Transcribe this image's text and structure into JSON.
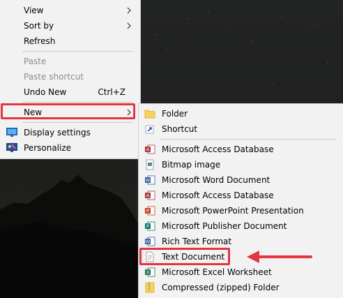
{
  "main_menu": {
    "items": [
      {
        "label": "View",
        "has_submenu": true,
        "enabled": true
      },
      {
        "label": "Sort by",
        "has_submenu": true,
        "enabled": true
      },
      {
        "label": "Refresh",
        "enabled": true
      },
      {
        "label": "Paste",
        "enabled": false
      },
      {
        "label": "Paste shortcut",
        "enabled": false
      },
      {
        "label": "Undo New",
        "shortcut": "Ctrl+Z",
        "enabled": true
      },
      {
        "label": "New",
        "has_submenu": true,
        "enabled": true,
        "highlighted": true
      },
      {
        "label": "Display settings",
        "icon": "display-settings-icon",
        "enabled": true
      },
      {
        "label": "Personalize",
        "icon": "personalize-icon",
        "enabled": true
      }
    ]
  },
  "new_submenu": {
    "items": [
      {
        "label": "Folder",
        "icon": "folder-icon"
      },
      {
        "label": "Shortcut",
        "icon": "shortcut-icon"
      },
      {
        "label": "Microsoft Access Database",
        "icon": "access-icon"
      },
      {
        "label": "Bitmap image",
        "icon": "bitmap-icon"
      },
      {
        "label": "Microsoft Word Document",
        "icon": "word-icon"
      },
      {
        "label": "Microsoft Access Database",
        "icon": "access-icon"
      },
      {
        "label": "Microsoft PowerPoint Presentation",
        "icon": "powerpoint-icon"
      },
      {
        "label": "Microsoft Publisher Document",
        "icon": "publisher-icon"
      },
      {
        "label": "Rich Text Format",
        "icon": "rtf-icon"
      },
      {
        "label": "Text Document",
        "icon": "text-document-icon",
        "highlighted": true
      },
      {
        "label": "Microsoft Excel Worksheet",
        "icon": "excel-icon"
      },
      {
        "label": "Compressed (zipped) Folder",
        "icon": "zip-folder-icon"
      }
    ]
  },
  "colors": {
    "menu_background": "#f2f2f2",
    "highlight_red": "#e3343f",
    "disabled_text": "#8c8c8c"
  }
}
